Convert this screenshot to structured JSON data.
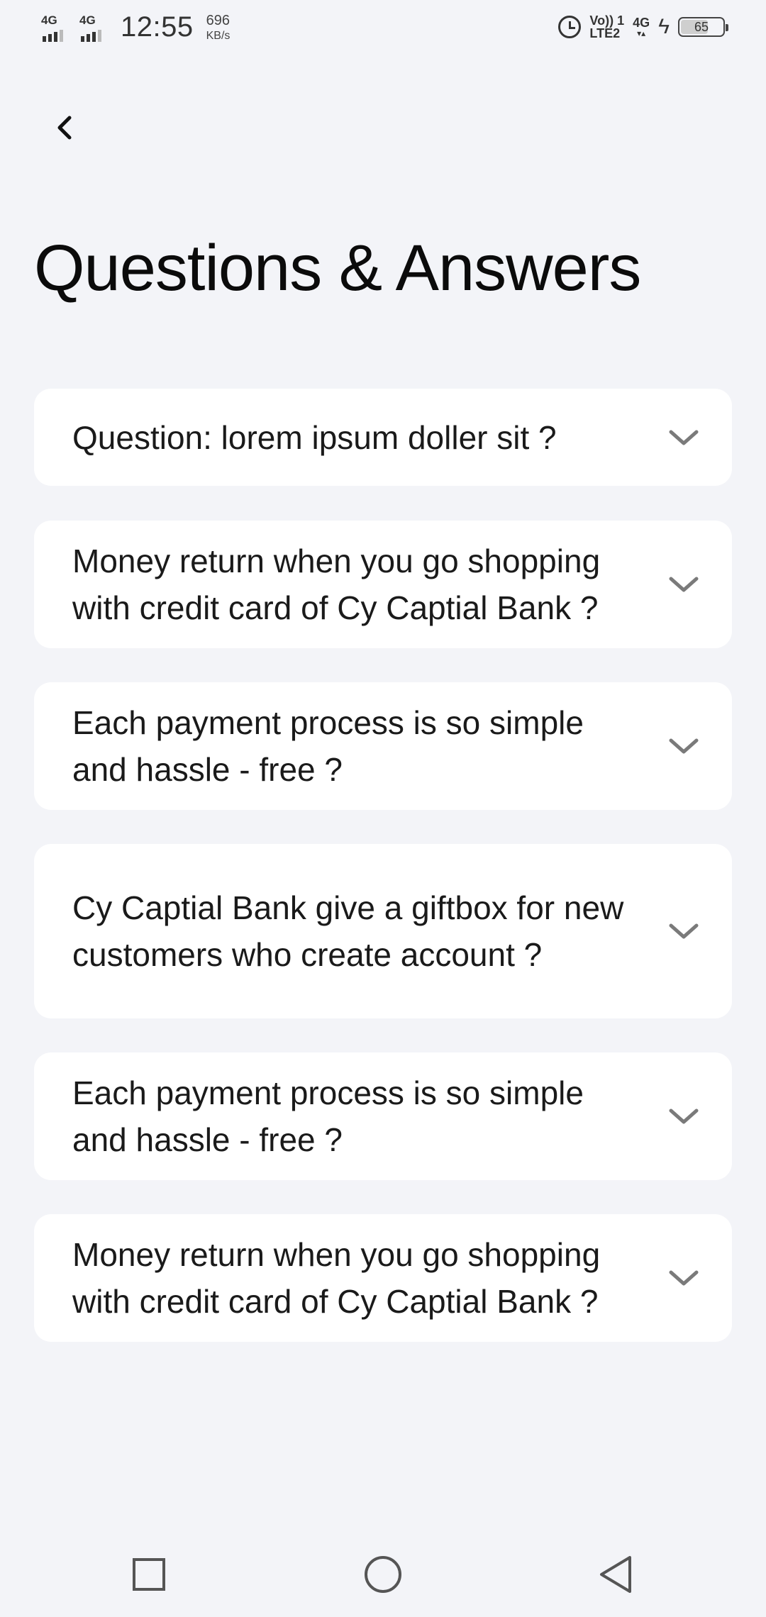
{
  "status_bar": {
    "sim1_network": "4G",
    "sim2_network": "4G",
    "time": "12:55",
    "speed_value": "696",
    "speed_unit": "KB/s",
    "volte_top": "Vo)) 1",
    "volte_bottom": "LTE2",
    "network_right": "4G",
    "battery_level": "65",
    "battery_fraction": 0.65
  },
  "header": {
    "back_icon": "chevron-left-icon",
    "title": "Questions & Answers"
  },
  "faq": [
    {
      "question": "Question: lorem ipsum doller sit ?"
    },
    {
      "question": "Money return when you go shopping with credit card of Cy Captial Bank ?"
    },
    {
      "question": "Each payment process is so simple and hassle - free ?"
    },
    {
      "question": "Cy Captial Bank give a giftbox for new customers who create account ?"
    },
    {
      "question": "Each payment process is so simple and hassle - free ?"
    },
    {
      "question": "Money return when you go shopping with credit card of Cy Captial Bank ?"
    }
  ],
  "nav": {
    "recent_icon": "square-icon",
    "home_icon": "circle-icon",
    "back_icon": "triangle-back-icon"
  },
  "colors": {
    "background": "#f3f4f8",
    "card": "#ffffff",
    "text": "#111111",
    "chevron": "#777777"
  }
}
